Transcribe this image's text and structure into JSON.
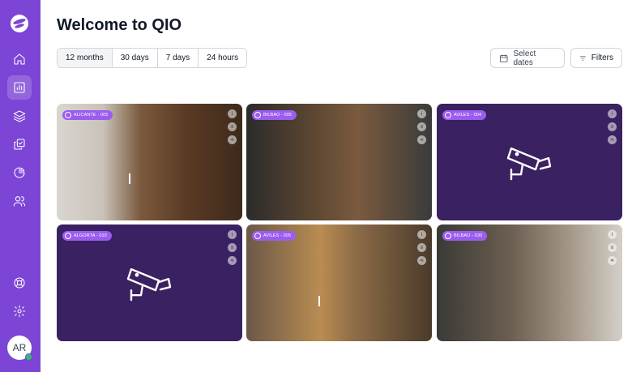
{
  "app": {
    "title": "Welcome to QIO"
  },
  "sidebar": {
    "items": [
      {
        "name": "home",
        "icon": "home-icon"
      },
      {
        "name": "dashboard",
        "icon": "bar-chart-icon",
        "active": true
      },
      {
        "name": "layers",
        "icon": "layers-icon"
      },
      {
        "name": "tasks",
        "icon": "checklist-icon"
      },
      {
        "name": "analytics",
        "icon": "pie-chart-icon"
      },
      {
        "name": "users",
        "icon": "users-icon"
      },
      {
        "name": "support",
        "icon": "lifebuoy-icon"
      },
      {
        "name": "settings",
        "icon": "gear-icon"
      }
    ],
    "avatar": {
      "initials": "AR",
      "status_color": "#22c55e"
    }
  },
  "toolbar": {
    "ranges": [
      "12 months",
      "30 days",
      "7 days",
      "24 hours"
    ],
    "selected_range": "12 months",
    "select_dates_label": "Select dates",
    "filters_label": "Filters"
  },
  "cameras": [
    {
      "label": "ALICANTE - 005",
      "type": "photo"
    },
    {
      "label": "BILBAO - 005",
      "type": "photo"
    },
    {
      "label": "AVILES - 004",
      "type": "placeholder"
    },
    {
      "label": "ALGORTA - 010",
      "type": "placeholder"
    },
    {
      "label": "AVILES - 005",
      "type": "photo"
    },
    {
      "label": "BILBAO - 030",
      "type": "photo"
    }
  ],
  "tile_actions": [
    {
      "icon": "info-icon",
      "glyph": "i"
    },
    {
      "icon": "chart-icon",
      "glyph": "≡"
    },
    {
      "icon": "share-icon",
      "glyph": "⋖"
    }
  ],
  "colors": {
    "sidebar": "#7c45d6",
    "placeholder_tile": "#3a2161",
    "badge": "#9b5cf0"
  }
}
